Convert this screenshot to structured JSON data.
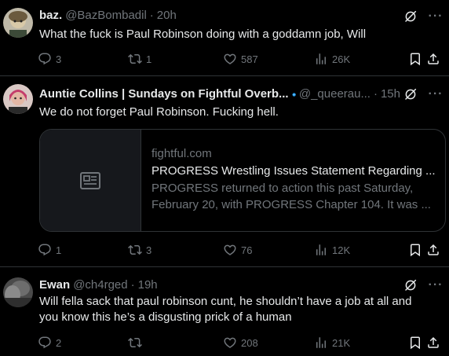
{
  "tweets": [
    {
      "name": "baz.",
      "handle": "@BazBombadil",
      "separator": "·",
      "time": "20h",
      "text": "What the fuck is Paul Robinson doing with a goddamn job, Will",
      "replies": "3",
      "retweets": "1",
      "likes": "587",
      "views": "26K"
    },
    {
      "name": "Auntie Collins | Sundays on Fightful Overb...",
      "handle": "@_queerau...",
      "separator": "·",
      "time": "15h",
      "text": "We do not forget Paul Robinson. Fucking hell.",
      "card": {
        "domain": "fightful.com",
        "title": "PROGRESS Wrestling Issues Statement Regarding ...",
        "desc_line1": "PROGRESS returned to action this past Saturday,",
        "desc_line2": "February 20, with PROGRESS Chapter 104.  It was ..."
      },
      "replies": "1",
      "retweets": "3",
      "likes": "76",
      "views": "12K"
    },
    {
      "name": "Ewan",
      "handle": "@ch4rged",
      "separator": "·",
      "time": "19h",
      "text_line1": "Will fella sack that paul robinson cunt, he shouldn’t have a job at all and",
      "text_line2": "you know this he’s a disgusting prick of a human",
      "replies": "2",
      "retweets": "",
      "likes": "208",
      "views": "21K"
    }
  ],
  "colors": {
    "background": "#000000",
    "text": "#e7e9ea",
    "muted": "#71767b",
    "border": "#2f3336",
    "verified": "#1d9bf0"
  },
  "icons": [
    "reply-icon",
    "retweet-icon",
    "like-icon",
    "views-icon",
    "bookmark-icon",
    "share-icon",
    "grok-icon",
    "more-icon",
    "verified-icon",
    "article-icon"
  ]
}
